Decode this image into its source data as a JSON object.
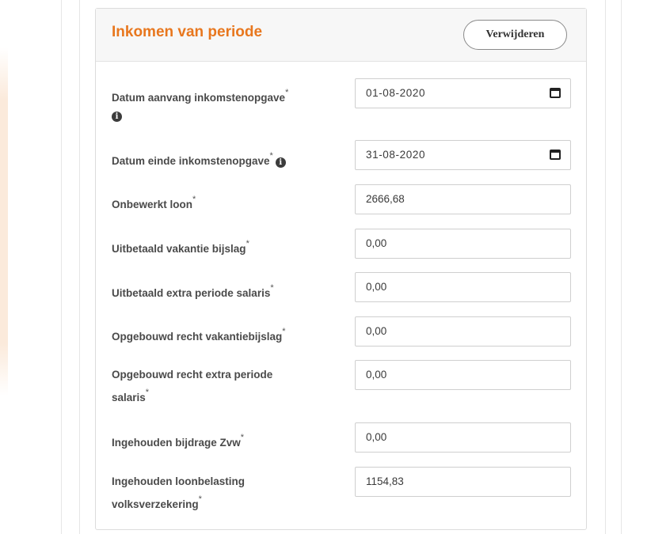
{
  "card": {
    "title": "Inkomen van periode",
    "delete_label": "Verwijderen"
  },
  "fields": [
    {
      "label": "Datum aanvang inkomstenopgave",
      "required_mark": "*",
      "value": "01-08-2020",
      "type": "date",
      "info_icon": "info-circle-icon"
    },
    {
      "label": "Datum einde inkomstenopgave",
      "required_mark": "*",
      "value": "31-08-2020",
      "type": "date",
      "info_icon": "info-circle-icon"
    },
    {
      "label": "Onbewerkt loon",
      "required_mark": "*",
      "value": "2666,68",
      "type": "text"
    },
    {
      "label": "Uitbetaald vakantie bijslag",
      "required_mark": "*",
      "value": "0,00",
      "type": "text"
    },
    {
      "label": "Uitbetaald extra periode salaris",
      "required_mark": "*",
      "value": "0,00",
      "type": "text"
    },
    {
      "label": "Opgebouwd recht vakantiebijslag",
      "required_mark": "*",
      "value": "0,00",
      "type": "text"
    },
    {
      "label_line1": "Opgebouwd recht extra periode",
      "label_line2": "salaris",
      "required_mark": "*",
      "value": "0,00",
      "type": "text"
    },
    {
      "label": "Ingehouden bijdrage Zvw",
      "required_mark": "*",
      "value": "0,00",
      "type": "text"
    },
    {
      "label_line1": "Ingehouden loonbelasting",
      "label_line2": "volksverzekering",
      "required_mark": "*",
      "value": "1154,83",
      "type": "text"
    }
  ],
  "colors": {
    "accent": "#e8771e",
    "header_bg": "#f7f7f7",
    "label_text": "#4a4a4a"
  }
}
